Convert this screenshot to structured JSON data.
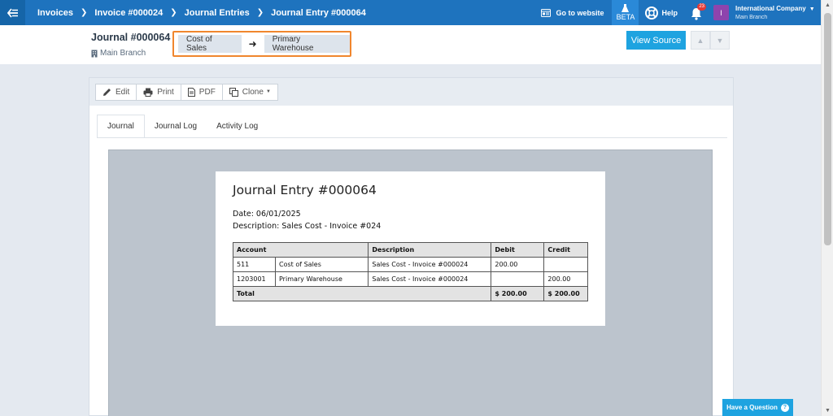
{
  "topbar": {
    "breadcrumbs": [
      "Invoices",
      "Invoice #000024",
      "Journal Entries",
      "Journal Entry #000064"
    ],
    "go_to_website": "Go to website",
    "beta": "BETA",
    "help": "Help",
    "notifications_count": "23",
    "company_initial": "I",
    "company_name": "International Company",
    "company_branch": "Main Branch"
  },
  "header": {
    "title": "Journal #000064",
    "branch": "Main Branch",
    "flow_from": "Cost of Sales",
    "flow_to": "Primary Warehouse",
    "view_source": "View Source"
  },
  "toolbar": {
    "edit": "Edit",
    "print": "Print",
    "pdf": "PDF",
    "clone": "Clone"
  },
  "tabs": [
    "Journal",
    "Journal Log",
    "Activity Log"
  ],
  "document": {
    "title": "Journal Entry #000064",
    "date": "Date: 06/01/2025",
    "description": "Description: Sales Cost - Invoice #024",
    "columns": [
      "Account",
      "Description",
      "Debit",
      "Credit"
    ],
    "rows": [
      {
        "code": "511",
        "account": "Cost of Sales",
        "description": "Sales Cost - Invoice #000024",
        "debit": "200.00",
        "credit": ""
      },
      {
        "code": "1203001",
        "account": "Primary Warehouse",
        "description": "Sales Cost - Invoice #000024",
        "debit": "",
        "credit": "200.00"
      }
    ],
    "total_label": "Total",
    "total_debit": "$ 200.00",
    "total_credit": "$ 200.00"
  },
  "have_question": "Have a Question"
}
